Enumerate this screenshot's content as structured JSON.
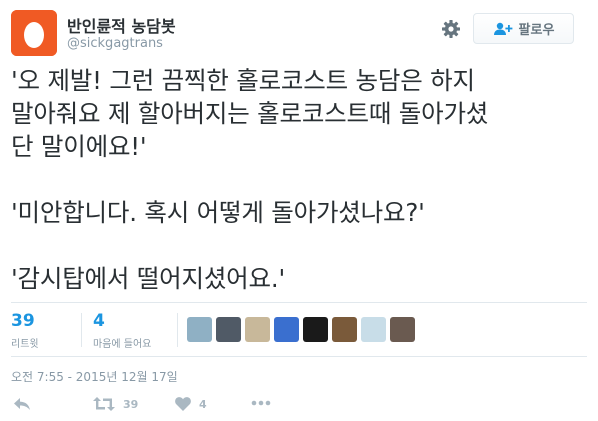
{
  "header": {
    "display_name": "반인륜적 농담봇",
    "handle": "@sickgagtrans",
    "follow_label": "팔로우"
  },
  "tweet": {
    "lines": [
      "'오 제발! 그런 끔찍한 홀로코스트 농담은 하지",
      "말아줘요 제 할아버지는 홀로코스트때 돌아가셨",
      "단 말이에요!'",
      "'미안합니다. 혹시 어떻게 돌아가셨나요?'",
      "'감시탑에서 떨어지셨어요.'"
    ]
  },
  "stats": {
    "retweets": {
      "count": "39",
      "label": "리트윗"
    },
    "likes": {
      "count": "4",
      "label": "마음에 들어요"
    },
    "liker_avatars": [
      {
        "icon": "avatar-1",
        "color": "#8fb0c4"
      },
      {
        "icon": "avatar-2",
        "color": "#505a66"
      },
      {
        "icon": "avatar-3",
        "color": "#c8b89a"
      },
      {
        "icon": "avatar-4",
        "color": "#3a6fcf"
      },
      {
        "icon": "avatar-5",
        "color": "#1a1a1a"
      },
      {
        "icon": "avatar-6",
        "color": "#7a5a3a"
      },
      {
        "icon": "avatar-7",
        "color": "#c8dde8"
      },
      {
        "icon": "avatar-8",
        "color": "#6a5a50"
      }
    ]
  },
  "timestamp": "오전 7:55 - 2015년 12월 17일",
  "actions": {
    "reply_icon": "reply-icon",
    "retweet_icon": "retweet-icon",
    "retweet_count": "39",
    "like_icon": "heart-icon",
    "like_count": "4",
    "more_icon": "more-icon"
  },
  "colors": {
    "avatar_bg": "#f05a24",
    "link_blue": "#1b95e0",
    "muted": "#8899a6",
    "text": "#292f33"
  }
}
